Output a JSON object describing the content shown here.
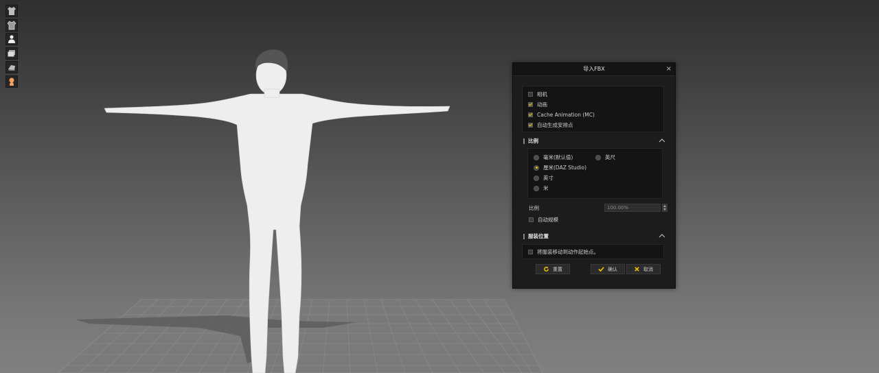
{
  "toolbar": {
    "buttons": [
      {
        "name": "shirt-icon"
      },
      {
        "name": "shirt-outline-icon"
      },
      {
        "name": "person-icon"
      },
      {
        "name": "layers-icon"
      },
      {
        "name": "fabric-icon"
      },
      {
        "name": "avatar-icon"
      }
    ]
  },
  "dialog": {
    "title": "导入FBX",
    "close_glyph": "×",
    "options": {
      "camera": {
        "label": "相机",
        "checked": false
      },
      "animation": {
        "label": "动画",
        "checked": true
      },
      "cache_animation": {
        "label": "Cache Animation (MC)",
        "checked": true
      },
      "auto_arrangement": {
        "label": "自动生成安排点",
        "checked": true
      }
    },
    "scale_section": {
      "title": "比例",
      "units": {
        "mm": {
          "label": "毫米(默认值)",
          "selected": false
        },
        "cm": {
          "label": "厘米(DAZ Studio)",
          "selected": true
        },
        "inch": {
          "label": "英寸",
          "selected": false
        },
        "m": {
          "label": "米",
          "selected": false
        },
        "feet": {
          "label": "英尺",
          "selected": false
        }
      },
      "scale_label": "比例",
      "scale_value": "100.00%",
      "auto_scale": {
        "label": "自动规模",
        "checked": false
      }
    },
    "garment_section": {
      "title": "服装位置",
      "move_to_arrangement": {
        "label": "将服装移动到动作起始点。",
        "checked": false
      }
    },
    "buttons": {
      "reset": "重置",
      "confirm": "确认",
      "cancel": "取消"
    }
  },
  "colors": {
    "accent": "#f2c200",
    "dialog_bg": "#1c1c1c",
    "panel_bg": "#141414"
  }
}
